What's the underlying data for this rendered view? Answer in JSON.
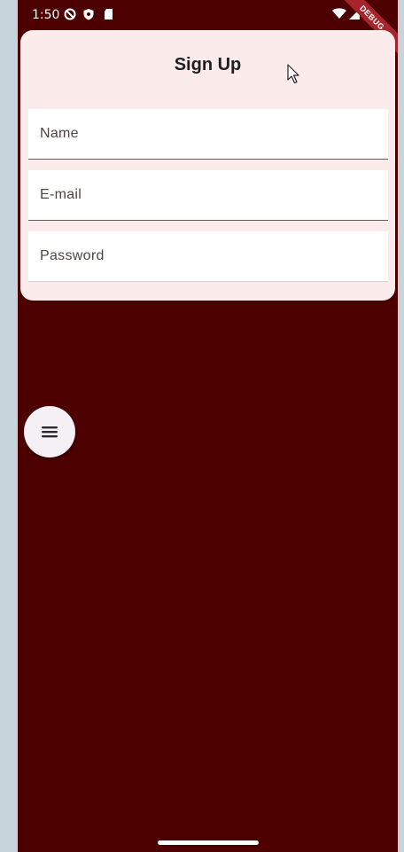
{
  "status_bar": {
    "time": "1:50",
    "icons_left": [
      "do-not-disturb-icon",
      "shield-icon",
      "sd-card-icon"
    ],
    "icons_right": [
      "wifi-icon",
      "signal-icon",
      "battery-icon"
    ]
  },
  "debug_banner": "DEBUG",
  "signup": {
    "title": "Sign Up",
    "fields": [
      {
        "label": "Name"
      },
      {
        "label": "E-mail"
      },
      {
        "label": "Password"
      }
    ]
  },
  "fab": {
    "icon": "menu-icon"
  },
  "colors": {
    "background": "#4d0000",
    "card": "#fcebeb",
    "field": "#ffffff",
    "fab": "#f5f0f5",
    "debug_ribbon": "#a8242d"
  }
}
